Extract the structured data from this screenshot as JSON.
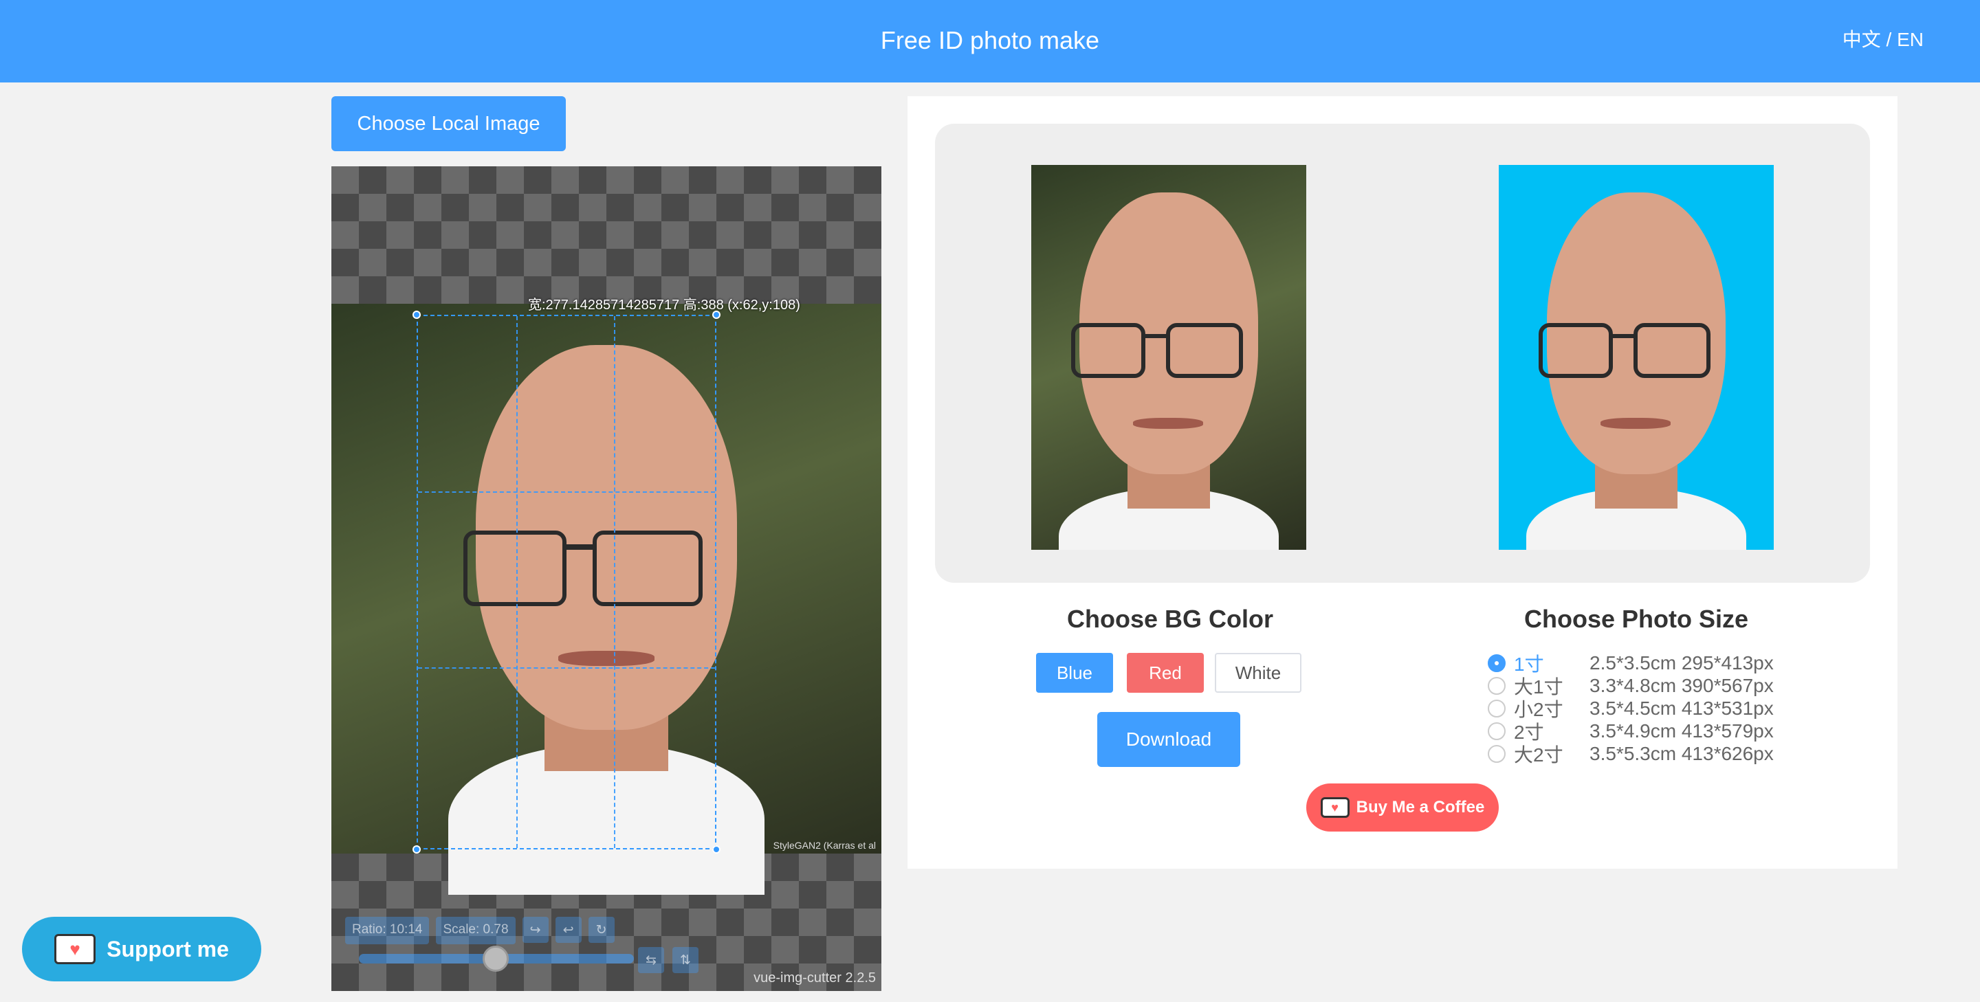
{
  "header": {
    "title": "Free ID photo make",
    "lang_switch": "中文 / EN"
  },
  "upload": {
    "label": "Choose Local Image"
  },
  "cropper": {
    "info_label": "宽:277.14285714285717 高:388 (x:62,y:108)",
    "ratio_label": "Ratio: 10:14",
    "scale_label": "Scale: 0.78",
    "version": "vue-img-cutter 2.2.5",
    "watermark": "StyleGAN2 (Karras et al"
  },
  "preview": {
    "original_alt": "original",
    "result_alt": "result"
  },
  "bg_color": {
    "title": "Choose BG Color",
    "options": [
      "Blue",
      "Red",
      "White"
    ],
    "selected_hex": "#00bff5"
  },
  "download": {
    "label": "Download"
  },
  "photo_size": {
    "title": "Choose Photo Size",
    "options": [
      {
        "name": "1寸",
        "spec": "2.5*3.5cm 295*413px",
        "selected": true
      },
      {
        "name": "大1寸",
        "spec": "3.3*4.8cm 390*567px",
        "selected": false
      },
      {
        "name": "小2寸",
        "spec": "3.5*4.5cm 413*531px",
        "selected": false
      },
      {
        "name": "2寸",
        "spec": "3.5*4.9cm 413*579px",
        "selected": false
      },
      {
        "name": "大2寸",
        "spec": "3.5*5.3cm 413*626px",
        "selected": false
      }
    ]
  },
  "coffee": {
    "label": "Buy Me a Coffee"
  },
  "support": {
    "label": "Support me"
  },
  "colors": {
    "primary": "#409eff",
    "red": "#f56c6c",
    "coffee": "#ff5f5f",
    "support": "#29abe0"
  }
}
